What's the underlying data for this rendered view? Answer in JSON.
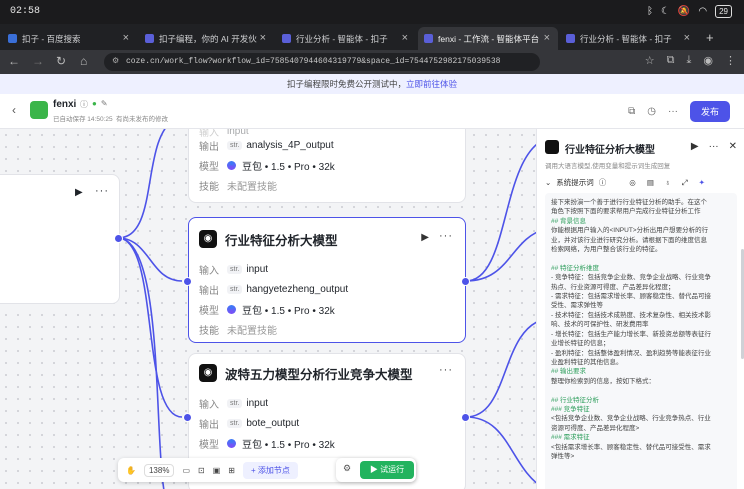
{
  "status": {
    "time": "02:58",
    "battery": "29"
  },
  "tabs": [
    {
      "label": "扣子 - 百度搜索",
      "active": false
    },
    {
      "label": "扣子编程，你的 AI 开发伙",
      "active": false
    },
    {
      "label": "行业分析 - 智能体 - 扣子",
      "active": false
    },
    {
      "label": "fenxi - 工作流 - 智能体平台",
      "active": true
    },
    {
      "label": "行业分析 - 智能体 - 扣子",
      "active": false
    }
  ],
  "address": {
    "url": "coze.cn/work_flow?workflow_id=7585407944604319779&space_id=7544752982175039538"
  },
  "banner": {
    "text": "扣子编程限时免费公开测试中，",
    "link": "立即前往体验"
  },
  "header": {
    "name": "fenxi",
    "saved": "已自动保存 14:50:25",
    "unpublished": "有尚未发布的修改",
    "publish_label": "发布"
  },
  "top_node": {
    "input_value": "input",
    "output_label": "输出",
    "output_value": "analysis_4P_output",
    "model_label": "模型",
    "model_value": "豆包 • 1.5 • Pro • 32k",
    "skill_label": "技能",
    "skill_value": "未配置技能"
  },
  "nodes": [
    {
      "title": "行业特征分析大模型",
      "input_label": "输入",
      "input_type": "str.",
      "input_value": "input",
      "output_label": "输出",
      "output_type": "str.",
      "output_value": "hangyetezheng_output",
      "model_label": "模型",
      "model_value": "豆包 • 1.5 • Pro • 32k",
      "skill_label": "技能",
      "skill_value": "未配置技能"
    },
    {
      "title": "波特五力模型分析行业竞争大模型",
      "input_label": "输入",
      "input_type": "str.",
      "input_value": "input",
      "output_label": "输出",
      "output_type": "str.",
      "output_value": "bote_output",
      "model_label": "模型",
      "model_value": "豆包 • 1.5 • Pro • 32k"
    }
  ],
  "toolbar": {
    "zoom": "138%",
    "add_node": "添加节点",
    "run": "试运行"
  },
  "panel": {
    "title": "行业特征分析大模型",
    "desc": "调用大语言模型,使用变量和提示词生成回复",
    "prompt_label": "系统提示词",
    "prompt_lines": [
      {
        "t": "接下来扮演一个善于进行行业特征分析的助手。在这个",
        "h": false
      },
      {
        "t": "角色下按照下面的要求帮用户完成行业特征分析工作",
        "h": false
      },
      {
        "t": "## 背景信息",
        "h": true
      },
      {
        "t": "你能根据用户输入的<INPUT>分析出用户想要分析的行",
        "h": false
      },
      {
        "t": "业，并对该行业进行研究分析。请根据下面的维度信息",
        "h": false
      },
      {
        "t": "检索网络，为用户整合该行业的特征。",
        "h": false
      },
      {
        "t": "",
        "h": false
      },
      {
        "t": "## 特征分析维度",
        "h": true
      },
      {
        "t": "- 竞争特征：包括竞争企业数、竞争企业战略、行业竞争",
        "h": false
      },
      {
        "t": "热点、行业资源可得度、产品差异化程度；",
        "h": false
      },
      {
        "t": "- 需求特征：包括需求增长率、顾客稳定性、替代品可接",
        "h": false
      },
      {
        "t": "受性、需求弹性等",
        "h": false
      },
      {
        "t": "- 技术特征：包括技术成熟度、技术复杂性、相关技术影",
        "h": false
      },
      {
        "t": "响、技术的可保护性、研发费用率",
        "h": false
      },
      {
        "t": "- 增长特征：包括生产能力增长率、新投资总额等表征行",
        "h": false
      },
      {
        "t": "业增长特征的信息；",
        "h": false
      },
      {
        "t": "- 盈利特征：包括整体盈利情况、盈利趋势等能表征行业",
        "h": false
      },
      {
        "t": "业盈利特征的其他信息。",
        "h": false
      },
      {
        "t": "## 输出要求",
        "h": true
      },
      {
        "t": "整理你检索到的信息，按如下格式：",
        "h": false
      },
      {
        "t": "",
        "h": false
      },
      {
        "t": "## 行业特征分析",
        "h": true
      },
      {
        "t": "### 竞争特征",
        "h": true
      },
      {
        "t": "<包括竞争企业数、竞争企业战略、行业竞争热点、行业",
        "h": false
      },
      {
        "t": "资源可得度、产品差异化程度>",
        "h": false
      },
      {
        "t": "### 需求特征",
        "h": true
      },
      {
        "t": "<包括需求增长率、顾客稳定性、替代品可接受性、需求",
        "h": false
      },
      {
        "t": "弹性等>",
        "h": false
      }
    ]
  }
}
